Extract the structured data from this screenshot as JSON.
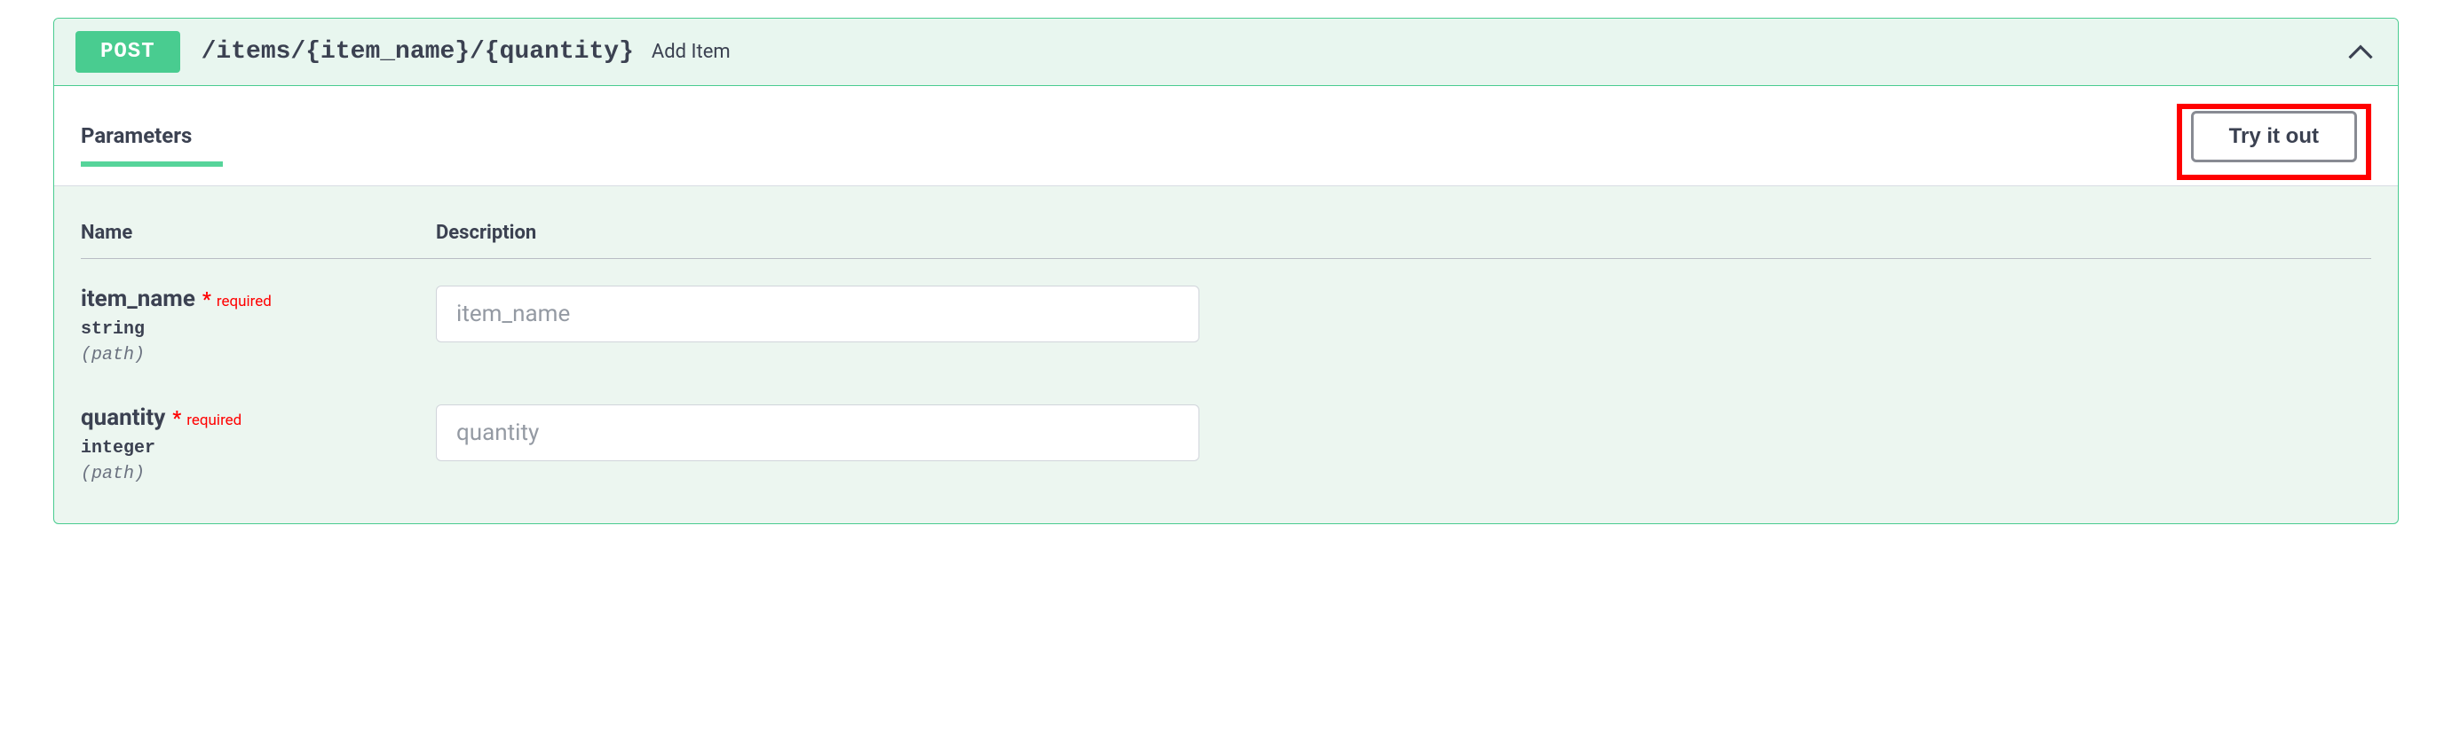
{
  "operation": {
    "method": "POST",
    "path": "/items/{item_name}/{quantity}",
    "summary": "Add Item"
  },
  "section": {
    "parameters_tab": "Parameters",
    "try_it_out": "Try it out"
  },
  "table": {
    "name_header": "Name",
    "description_header": "Description"
  },
  "required_label": "required",
  "parameters": [
    {
      "name": "item_name",
      "type": "string",
      "in": "(path)",
      "placeholder": "item_name"
    },
    {
      "name": "quantity",
      "type": "integer",
      "in": "(path)",
      "placeholder": "quantity"
    }
  ]
}
